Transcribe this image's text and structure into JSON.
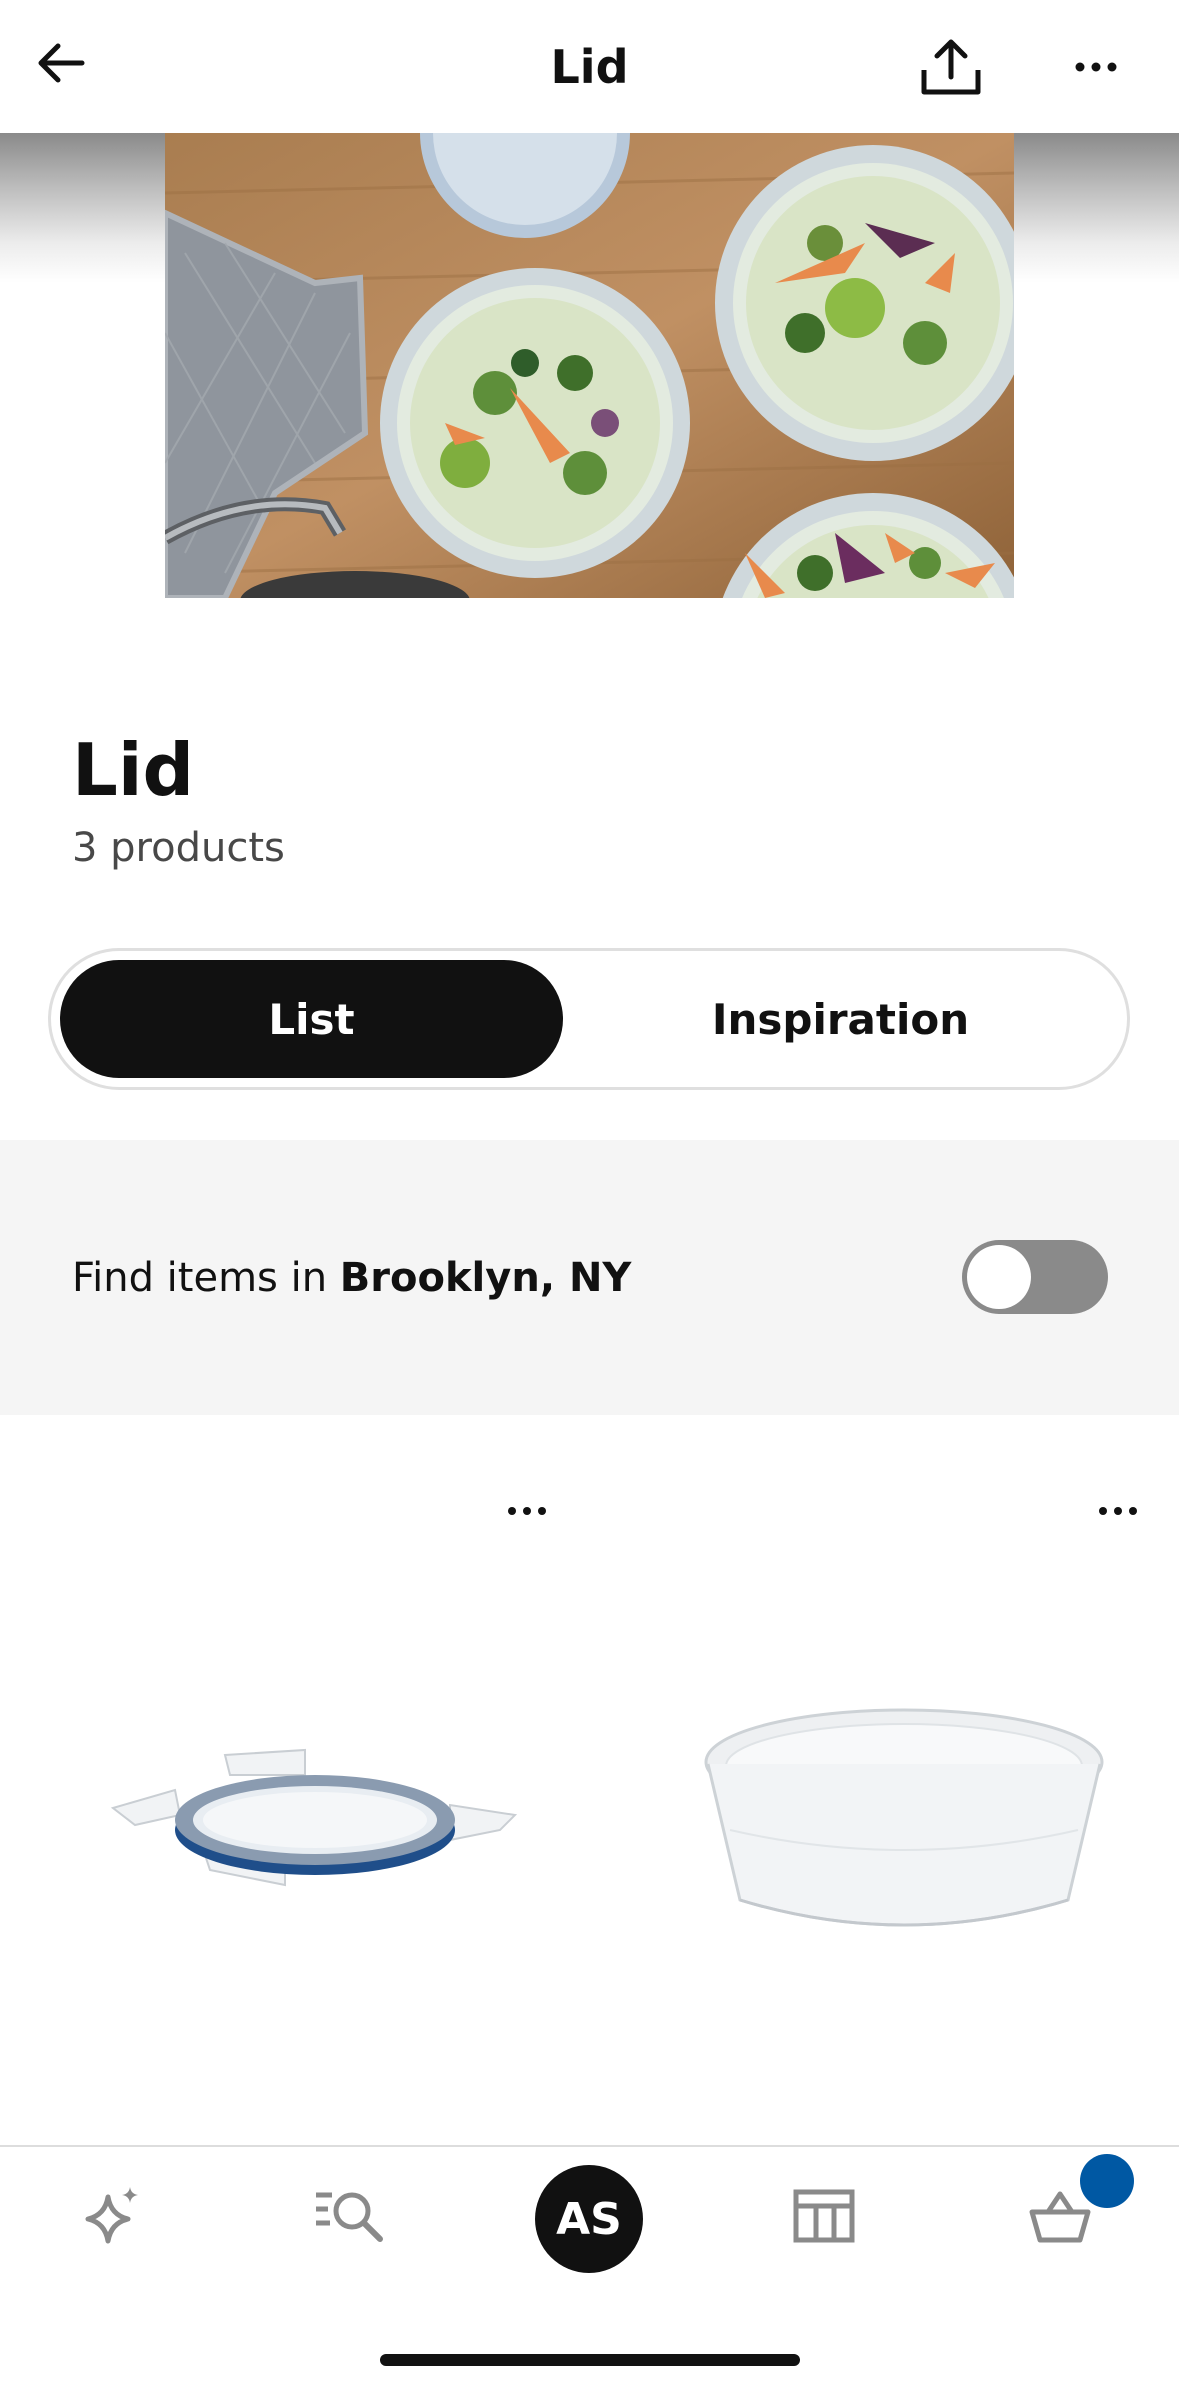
{
  "nav": {
    "title": "Lid"
  },
  "page": {
    "title": "Lid",
    "count": "3 products"
  },
  "view_toggle": {
    "list": "List",
    "inspiration": "Inspiration",
    "selected": "List"
  },
  "store": {
    "prefix": "Find items in ",
    "location": "Brooklyn, NY",
    "enabled": false
  },
  "bottom_nav": {
    "avatar_initials": "AS",
    "cart_badge_color": "#0058a3"
  },
  "colors": {
    "accent": "#111111",
    "badge": "#0058a3",
    "band": "#f5f5f5",
    "switch_off": "#8a8a8a"
  },
  "icons": [
    "back-arrow-icon",
    "share-icon",
    "more-icon",
    "sparkle-icon",
    "search-icon",
    "store-icon",
    "basket-icon"
  ]
}
